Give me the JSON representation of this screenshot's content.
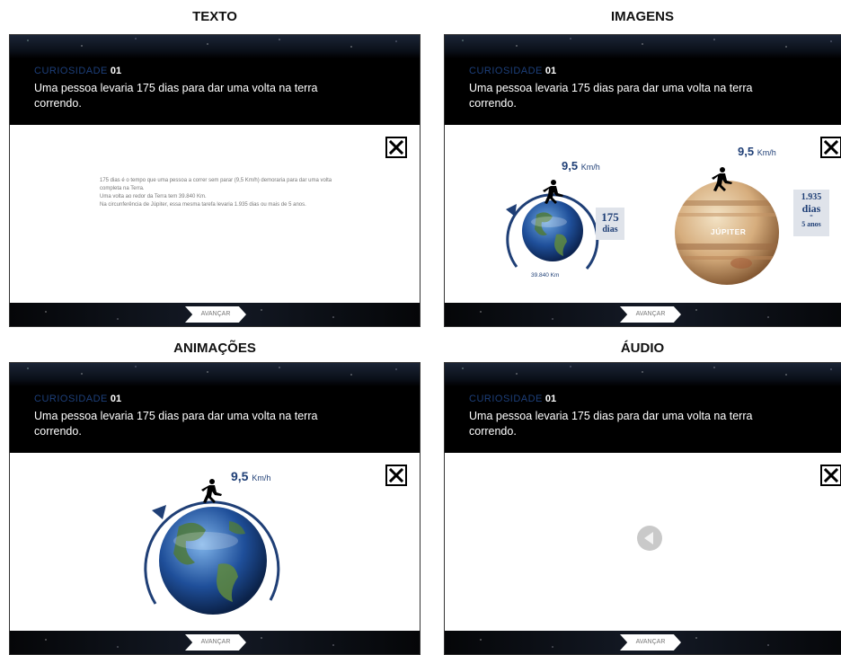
{
  "quadrants": {
    "texto": "TEXTO",
    "imagens": "IMAGENS",
    "animacoes": "ANIMAÇÕES",
    "audio": "ÁUDIO"
  },
  "slide": {
    "kicker": "CURIOSIDADE",
    "number": "01",
    "headline": "Uma pessoa levaria 175 dias para dar uma volta na terra correndo.",
    "advance_label": "AVANÇAR"
  },
  "texto_body": {
    "p1": "175 dias é o tempo que uma pessoa a correr sem parar (9,5 Km/h) demoraria para dar uma volta completa na Terra.",
    "p2": "Uma volta ao redor da Terra tem 39.840 Km.",
    "p3": "Na circunferência de Júpiter, essa mesma tarefa levaria 1.935 dias ou mais de 5 anos."
  },
  "imagens": {
    "speed_value": "9,5",
    "speed_unit": "Km/h",
    "earth_days_num": "175",
    "earth_days_word": "dias",
    "earth_circumference": "39.840 Km",
    "jupiter_label": "JÚPITER",
    "jupiter_days_num": "1.935",
    "jupiter_days_word": "dias",
    "jupiter_equals": "=",
    "jupiter_years": "5 anos"
  },
  "animacoes": {
    "speed_value": "9,5",
    "speed_unit": "Km/h"
  },
  "icons": {
    "close": "close-x-icon",
    "runner": "runner-icon",
    "play": "play-back-icon"
  },
  "colors": {
    "accent_blue": "#1f3f76",
    "kicker_blue": "#1d3f7a"
  }
}
